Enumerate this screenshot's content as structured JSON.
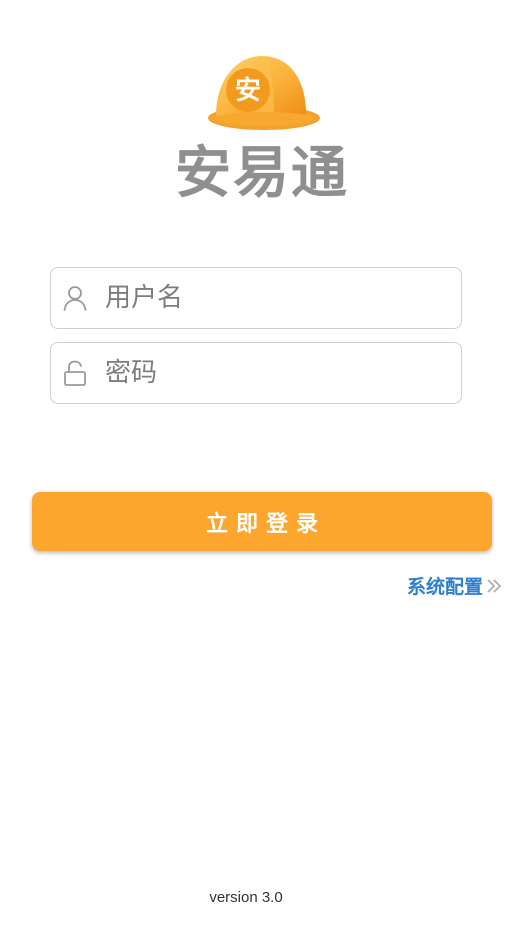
{
  "app": {
    "name": "安易通",
    "logo_glyph": "安",
    "logo_icon": "helmet-icon"
  },
  "login_form": {
    "username": {
      "placeholder": "用户名",
      "value": "",
      "icon": "user-icon"
    },
    "password": {
      "placeholder": "密码",
      "value": "",
      "icon": "lock-icon"
    },
    "submit_label": "立即登录"
  },
  "system_config": {
    "label": "系统配置",
    "icon": "double-chevron-right-icon"
  },
  "footer": {
    "version": "version 3.0"
  },
  "colors": {
    "accent": "#fda62e",
    "link": "#2e7fcf",
    "brand_text": "#8f8f8f"
  }
}
